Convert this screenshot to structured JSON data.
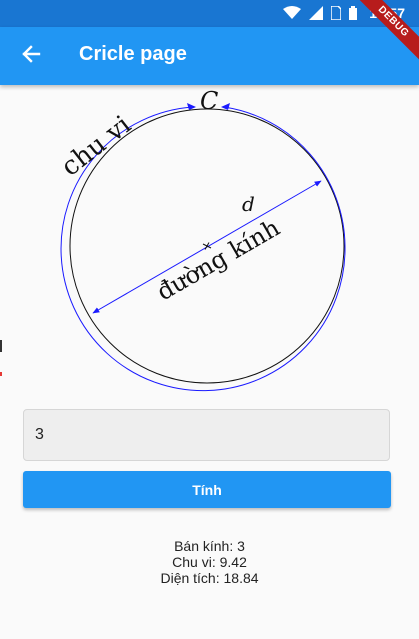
{
  "status_bar": {
    "time": "12:57",
    "icons": [
      "wifi-icon",
      "signal-icon",
      "sim-icon",
      "battery-icon"
    ],
    "debug_label": "DEBUG"
  },
  "app_bar": {
    "title": "Cricle page",
    "back_icon": "arrow-left-icon",
    "background": "#2196f3"
  },
  "diagram": {
    "circumference_label": "chu vi",
    "circumference_symbol": "C",
    "diameter_symbol": "d",
    "diameter_label": "đường kính"
  },
  "input": {
    "value": "3",
    "placeholder": ""
  },
  "button": {
    "label": "Tính",
    "color": "#2196f3"
  },
  "results": {
    "radius": "Bán kính: 3",
    "circumference": "Chu vi: 9.42",
    "area": "Diện tích: 18.84"
  }
}
